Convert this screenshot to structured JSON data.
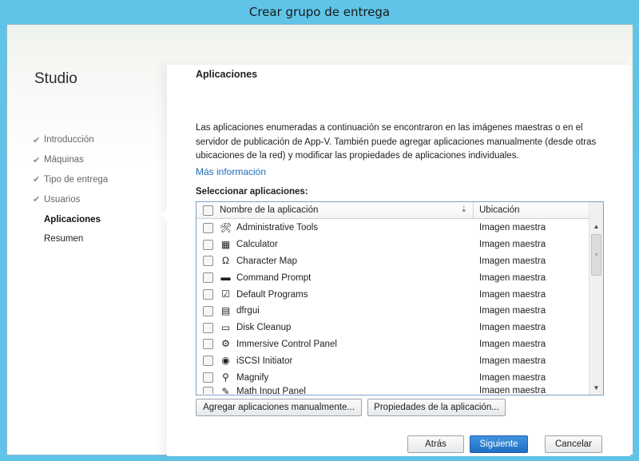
{
  "window": {
    "title": "Crear grupo de entrega"
  },
  "sidebar": {
    "brand": "Studio",
    "steps": [
      {
        "label": "Introducción",
        "state": "done"
      },
      {
        "label": "Máquinas",
        "state": "done"
      },
      {
        "label": "Tipo de entrega",
        "state": "done"
      },
      {
        "label": "Usuarios",
        "state": "done"
      },
      {
        "label": "Aplicaciones",
        "state": "active"
      },
      {
        "label": "Resumen",
        "state": "pending"
      }
    ]
  },
  "main": {
    "section_title": "Aplicaciones",
    "description": "Las aplicaciones enumeradas a continuación se encontraron en las imágenes maestras o en el servidor de publicación de App-V. También puede agregar aplicaciones manualmente (desde otras ubicaciones de la red) y modificar las propiedades de aplicaciones individuales.",
    "more_info_link": "Más información",
    "select_label": "Seleccionar aplicaciones:",
    "table": {
      "columns": {
        "name": "Nombre de la aplicación",
        "location": "Ubicación"
      },
      "rows": [
        {
          "name": "Administrative Tools",
          "location": "Imagen maestra",
          "icon": "admin-tools-icon",
          "glyph": "🛠"
        },
        {
          "name": "Calculator",
          "location": "Imagen maestra",
          "icon": "calculator-icon",
          "glyph": "▦"
        },
        {
          "name": "Character Map",
          "location": "Imagen maestra",
          "icon": "character-map-icon",
          "glyph": "Ω"
        },
        {
          "name": "Command Prompt",
          "location": "Imagen maestra",
          "icon": "command-prompt-icon",
          "glyph": "▬"
        },
        {
          "name": "Default Programs",
          "location": "Imagen maestra",
          "icon": "default-programs-icon",
          "glyph": "☑"
        },
        {
          "name": "dfrgui",
          "location": "Imagen maestra",
          "icon": "defrag-icon",
          "glyph": "▤"
        },
        {
          "name": "Disk Cleanup",
          "location": "Imagen maestra",
          "icon": "disk-cleanup-icon",
          "glyph": "▭"
        },
        {
          "name": "Immersive Control Panel",
          "location": "Imagen maestra",
          "icon": "gear-icon",
          "glyph": "⚙"
        },
        {
          "name": "iSCSI Initiator",
          "location": "Imagen maestra",
          "icon": "globe-icon",
          "glyph": "◉"
        },
        {
          "name": "Magnify",
          "location": "Imagen maestra",
          "icon": "magnifier-icon",
          "glyph": "⚲"
        },
        {
          "name": "Math Input Panel",
          "location": "Imagen maestra",
          "icon": "math-input-icon",
          "glyph": "✎"
        }
      ]
    },
    "add_manual_button": "Agregar aplicaciones manualmente...",
    "properties_button": "Propiedades de la aplicación..."
  },
  "footer": {
    "back": "Atrás",
    "next": "Siguiente",
    "cancel": "Cancelar"
  },
  "colors": {
    "title_bar": "#5fc4e8",
    "link": "#1e6fb5",
    "primary_button": "#2c7fd1"
  }
}
